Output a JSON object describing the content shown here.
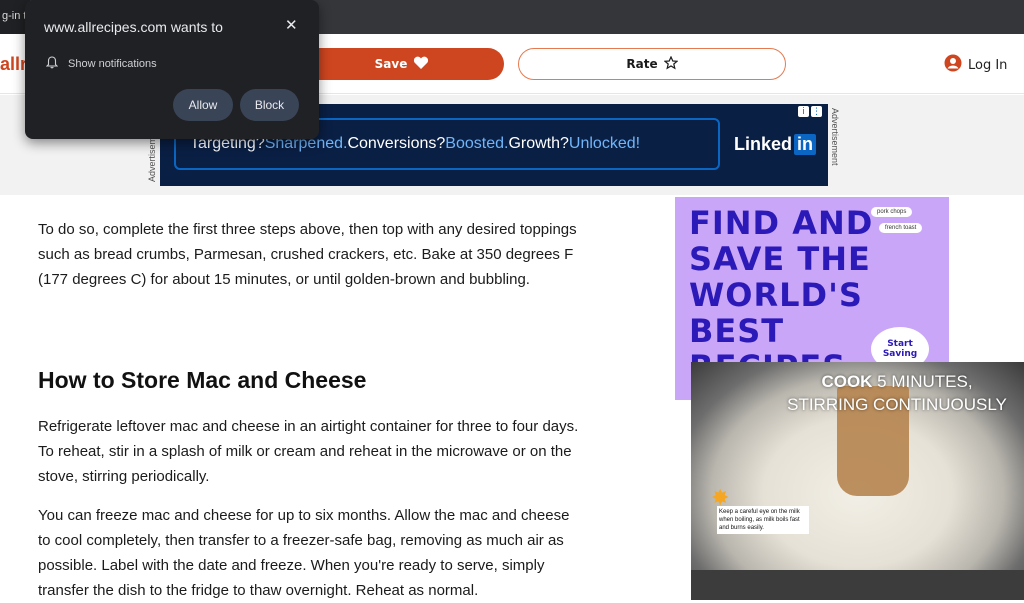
{
  "browser": {
    "tab_title": "g-in t"
  },
  "header": {
    "logo_text": "allre",
    "save_label": "Save",
    "rate_label": "Rate",
    "login_label": "Log In"
  },
  "top_ad": {
    "side_label": "Advertisement",
    "line_part1": "Targeting? ",
    "line_hl1": "Sharpened.",
    "line_part2": " Conversions? ",
    "line_hl2": "Boosted.",
    "line_part3": " Growth? ",
    "line_hl3": "Unlocked!",
    "brand_text": "Linked",
    "brand_in": "in"
  },
  "article": {
    "intro_paragraph": "To do so, complete the first three steps above, then top with any desired toppings such as bread crumbs, Parmesan, crushed crackers, etc. Bake at 350 degrees F (177 degrees C) for about 15 minutes, or until golden-brown and bubbling.",
    "store_heading": "How to Store Mac and Cheese",
    "store_paragraph": "Refrigerate leftover mac and cheese in an airtight container for three to four days. To reheat, stir in a splash of milk or cream and reheat in the microwave or on the stove, stirring periodically.",
    "freeze_paragraph": "You can freeze mac and cheese for up to six months. Allow the mac and cheese to cool completely, then transfer to a freezer-safe bag, removing as much air as possible. Label with the date and freeze. When you're ready to serve, simply transfer the dish to the fridge to thaw overnight. Reheat as normal."
  },
  "side_ad": {
    "headline": "FIND AND SAVE THE WORLD'S BEST RECIPES",
    "pill1": "pork chops",
    "pill2": "french toast",
    "badge": "Start Saving"
  },
  "video": {
    "caption_bold": "COOK",
    "caption_rest": " 5 MINUTES, STIRRING CONTINUOUSLY",
    "tip": "Keep a careful eye on the milk when boiling, as milk boils fast and burns easily."
  },
  "permission_popup": {
    "title": "www.allrecipes.com wants to",
    "item_label": "Show notifications",
    "allow_label": "Allow",
    "block_label": "Block"
  },
  "colors": {
    "brand": "#ce4620",
    "popup_bg": "#202124",
    "popup_button": "#394457",
    "ad_bg": "#0a1f44",
    "purple_ad": "#c9a6f7"
  }
}
